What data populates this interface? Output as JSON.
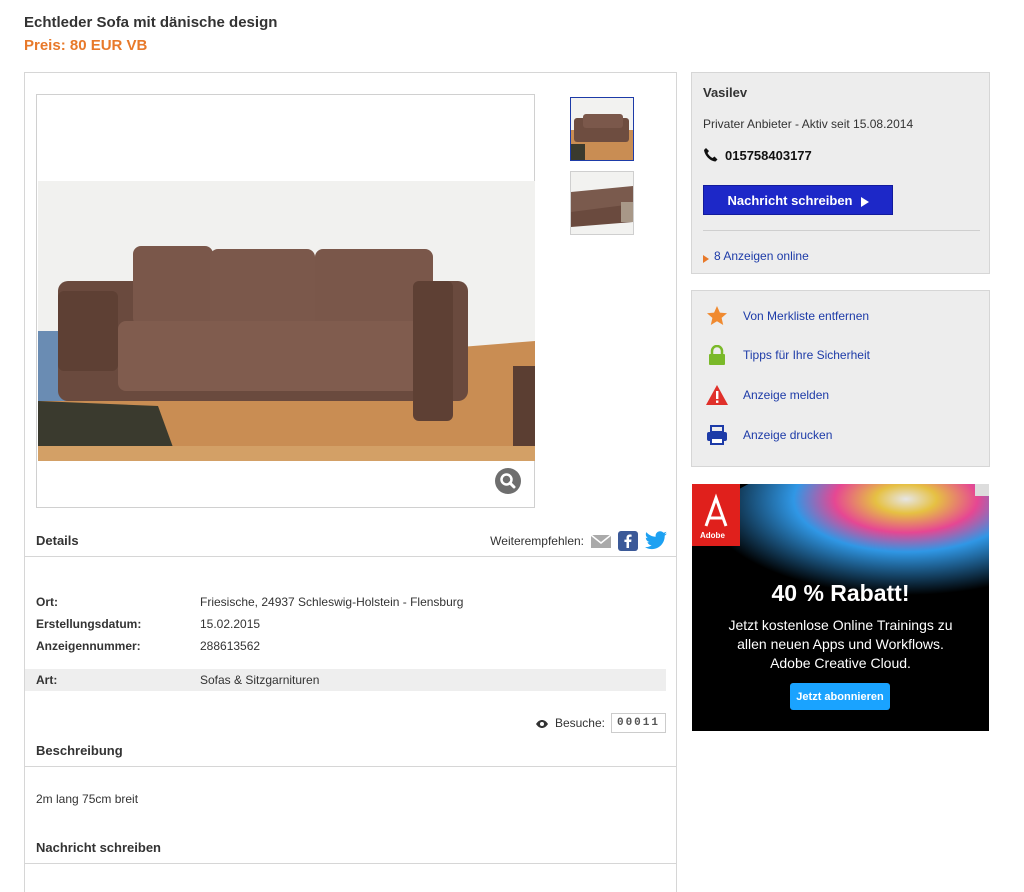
{
  "listing": {
    "title": "Echtleder Sofa mit dänische design",
    "price": "Preis: 80 EUR VB"
  },
  "details": {
    "heading": "Details",
    "share_label": "Weiterempfehlen:",
    "rows": [
      {
        "key": "Ort:",
        "value": "Friesische, 24937 Schleswig-Holstein - Flensburg"
      },
      {
        "key": "Erstellungsdatum:",
        "value": "15.02.2015"
      },
      {
        "key": "Anzeigennummer:",
        "value": "288613562"
      },
      {
        "key": "Art:",
        "value": "Sofas & Sitzgarnituren"
      }
    ],
    "visits_label": "Besuche:",
    "visits_count": "00011"
  },
  "description": {
    "heading": "Beschreibung",
    "text": "2m lang 75cm breit"
  },
  "message_section": {
    "heading": "Nachricht schreiben"
  },
  "seller": {
    "name": "Vasilev",
    "subtitle": "Privater Anbieter - Aktiv seit 15.08.2014",
    "phone": "015758403177",
    "message_button": "Nachricht schreiben",
    "ads_online": "8 Anzeigen online"
  },
  "actions": [
    {
      "label": "Von Merkliste entfernen",
      "icon": "star-icon"
    },
    {
      "label": "Tipps für Ihre Sicherheit",
      "icon": "lock-icon"
    },
    {
      "label": "Anzeige melden",
      "icon": "warning-icon"
    },
    {
      "label": "Anzeige drucken",
      "icon": "printer-icon"
    }
  ],
  "ad": {
    "brand": "Adobe",
    "headline": "40 % Rabatt!",
    "line1": "Jetzt kostenlose Online Trainings zu",
    "line2": "allen neuen Apps und Workflows.",
    "line3": "Adobe Creative Cloud.",
    "button": "Jetzt abonnieren"
  },
  "colors": {
    "price": "#e8792a",
    "link": "#1d3ba8",
    "button": "#1d28c8",
    "star": "#f08a30",
    "lock": "#7ab929",
    "warning": "#e0302a",
    "printer": "#1d3ba8",
    "ad_button": "#1aa3ff"
  }
}
